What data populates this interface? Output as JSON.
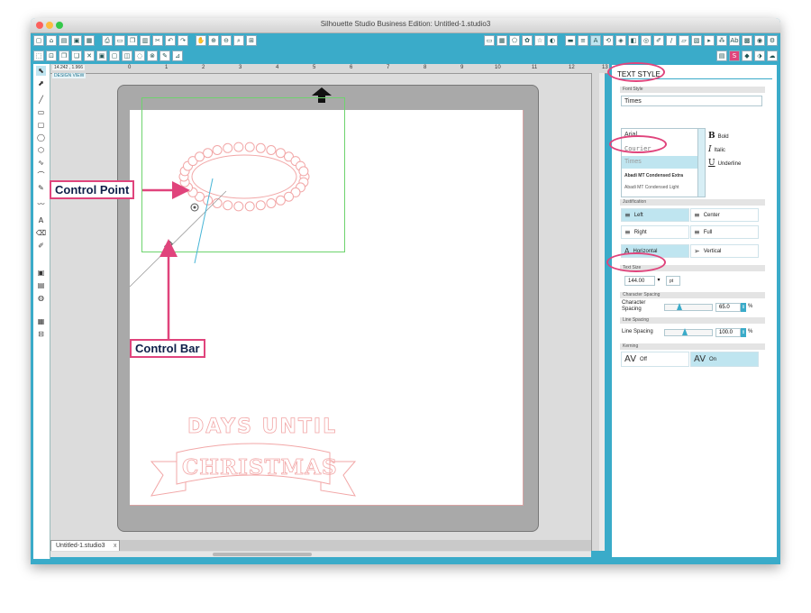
{
  "window": {
    "title": "Silhouette Studio Business Edition: Untitled-1.studio3"
  },
  "toolbar": {
    "row1_icons": [
      "new-doc-icon",
      "open-icon",
      "open-library-icon",
      "save-icon",
      "save-as-icon",
      "print-icon",
      "print-cut-icon",
      "copy-icon",
      "paste-icon",
      "cut-icon",
      "undo-icon",
      "redo-icon",
      "pan-icon",
      "zoom-in-icon",
      "zoom-out-icon",
      "zoom-select-icon",
      "fit-page-icon"
    ],
    "row1_right_icons": [
      "page-setup-icon",
      "grid-icon",
      "shapes-icon",
      "library-icon",
      "store-icon",
      "settings-icon",
      "offset-icon",
      "trace-icon",
      "text-style-icon",
      "transform-icon",
      "replicate-icon",
      "modify-icon",
      "knife-icon",
      "eraser-icon",
      "send-icon",
      "rhinestone-icon",
      "layers-icon",
      "nest-icon",
      "align-icon",
      "fill-icon",
      "text-icon",
      "sketch-icon",
      "gear-icon"
    ],
    "row2_icons": [
      "select-all-icon",
      "deselect-icon",
      "duplicate-icon",
      "delete-icon",
      "group-icon",
      "ungroup-icon",
      "compound-icon",
      "release-icon",
      "weld-icon",
      "point-edit-icon"
    ]
  },
  "ruler": {
    "coords": "14.242 , 1.966",
    "design_view": "DESIGN VIEW",
    "ticks": [
      "0",
      "1",
      "2",
      "3",
      "4",
      "5",
      "6",
      "7",
      "8",
      "9",
      "10",
      "11",
      "12",
      "13"
    ]
  },
  "canvas": {
    "text1": "DAYS UNTIL",
    "text2": "CHRISTMAS"
  },
  "document_tab": {
    "label": "Untitled-1.studio3",
    "close": "x"
  },
  "panel": {
    "title": "TEXT STYLE",
    "font_style_label": "Font Style",
    "font_input": "Times",
    "font_list": [
      "Arial",
      "Courier",
      "Times",
      "Abadi MT Condensed Extra",
      "Abadi MT Condensed Light"
    ],
    "styles": [
      {
        "glyph": "B",
        "label": "Bold"
      },
      {
        "glyph": "I",
        "label": "Italic"
      },
      {
        "glyph": "U",
        "label": "Underline"
      }
    ],
    "justification_label": "Justification",
    "justification": [
      {
        "label": "Left",
        "selected": true
      },
      {
        "label": "Center",
        "selected": false
      },
      {
        "label": "Right",
        "selected": false
      },
      {
        "label": "Full",
        "selected": false
      },
      {
        "label": "Horizontal",
        "selected": true
      },
      {
        "label": "Vertical",
        "selected": false
      }
    ],
    "text_size_label": "Text Size",
    "text_size": "144.00",
    "text_size_unit": "pt",
    "char_spacing_section": "Character Spacing",
    "char_spacing_label": "Character Spacing",
    "char_spacing_value": "65.0",
    "char_spacing_level": 0.3,
    "line_spacing_section": "Line Spacing",
    "line_spacing_label": "Line Spacing",
    "line_spacing_value": "100.0",
    "line_spacing_level": 0.4,
    "pct": "%",
    "kerning_label": "Kerning",
    "kerning_off": "Off",
    "kerning_on": "On",
    "kerning_glyph": "AV"
  },
  "annotations": {
    "control_point": "Control Point",
    "control_bar": "Control Bar",
    "accent_color": "#e0447c",
    "label_color": "#0f1f49"
  },
  "colors": {
    "chrome": "#3aabc9",
    "guide_green": "#6dd36d",
    "text_outline": "#f2a7a7"
  }
}
